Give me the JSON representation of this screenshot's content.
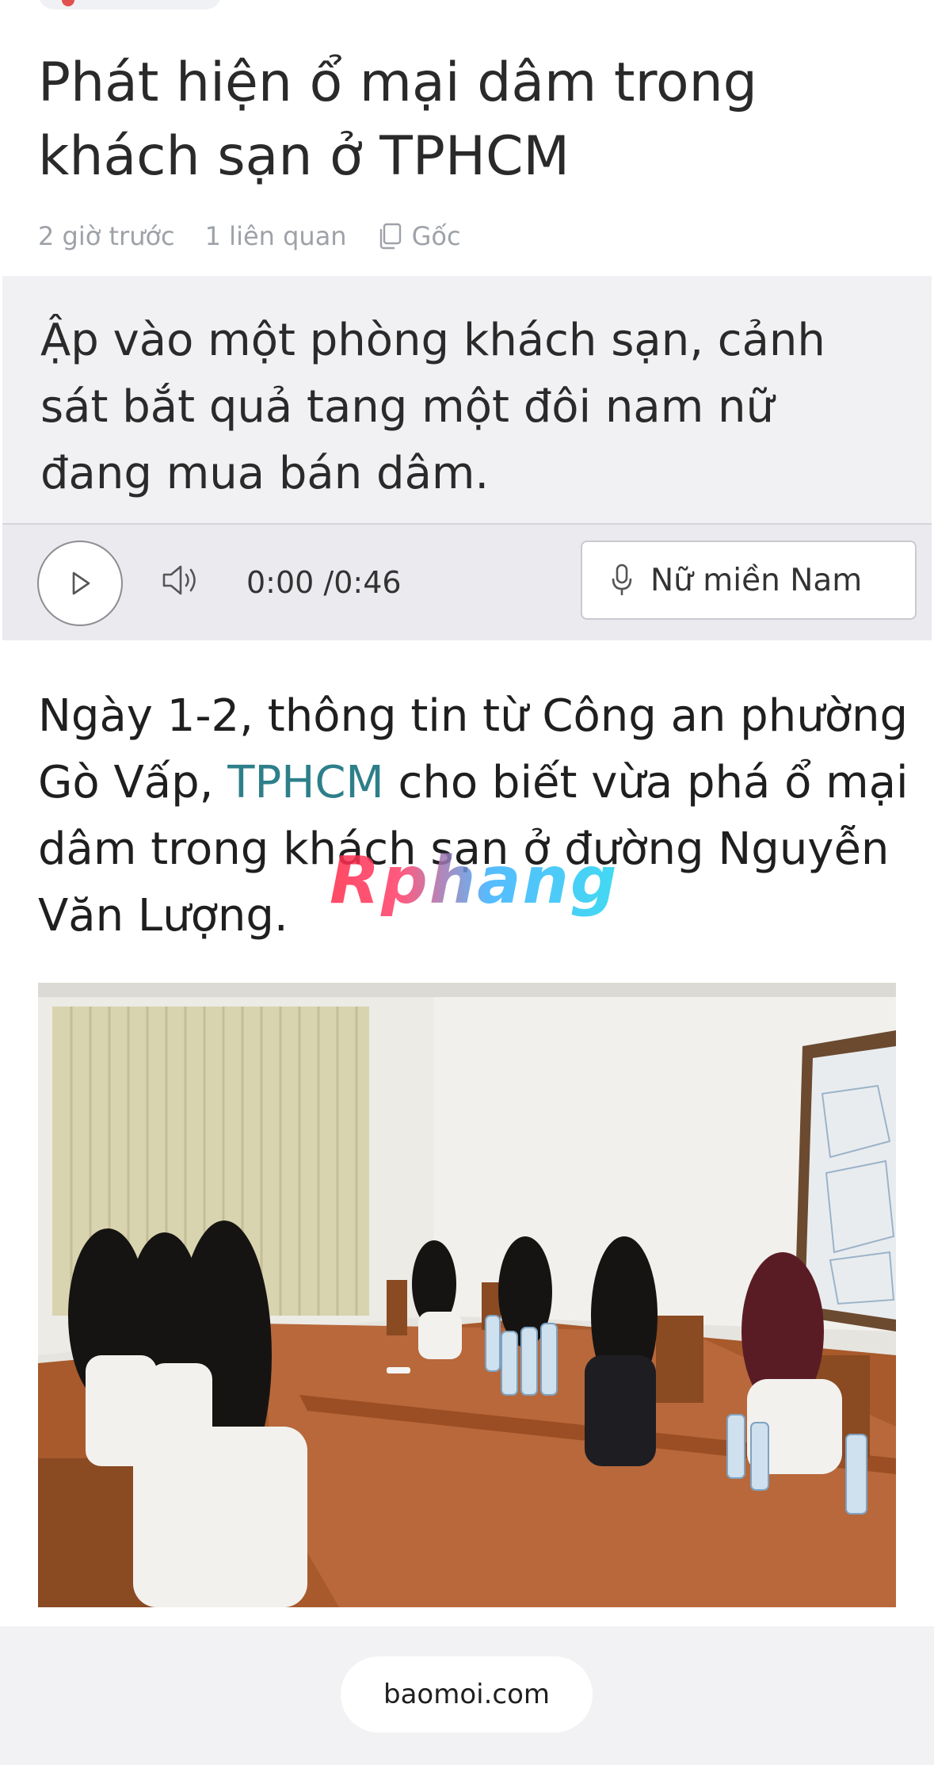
{
  "article": {
    "title": "Phát hiện ổ mại dâm trong khách sạn ở TPHCM",
    "meta": {
      "time": "2 giờ trước",
      "related": "1 liên quan",
      "source": "Gốc",
      "source_icon": "copy-icon"
    },
    "summary": "Ập vào một phòng khách sạn, cảnh sát bắt quả tang một đôi nam nữ đang mua bán dâm.",
    "body": {
      "before_link": "Ngày 1-2, thông tin từ Công an phường Gò Vấp, ",
      "link": "TPHCM",
      "after_link": " cho biết vừa phá ổ mại dâm trong khách sạn ở đường Nguyễn Văn Lượng."
    },
    "image_alt": "",
    "watermark": "Rphang"
  },
  "player": {
    "play_icon": "play-icon",
    "volume_icon": "volume-icon",
    "time": "0:00 /0:46",
    "voice_icon": "microphone-icon",
    "voice_label": "Nữ miền Nam"
  },
  "footer": {
    "domain": "baomoi.com"
  },
  "colors": {
    "link": "#2d7f8a",
    "summary_bg": "#f1f1f3",
    "meta_text": "#9ea2a8"
  }
}
